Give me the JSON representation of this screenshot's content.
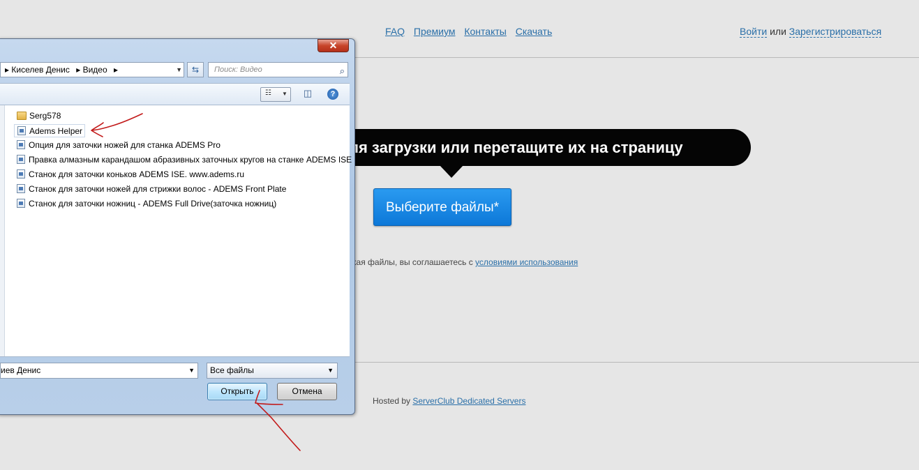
{
  "site": {
    "nav": [
      "FAQ",
      "Премиум",
      "Контакты",
      "Скачать"
    ],
    "auth": {
      "login": "Войти",
      "or": "или",
      "register": "Зарегистрироваться"
    },
    "bubble_text": "ля загрузки или перетащите их на страницу",
    "choose_button": "Выберите файлы*",
    "terms_prefix": "кая файлы, вы соглашаетесь с",
    "terms_link": "условиями использования",
    "hosted_prefix": "Hosted by",
    "hosted_link": "ServerClub Dedicated Servers"
  },
  "dialog": {
    "close_glyph": "✕",
    "address": {
      "seg1": "Киселев Денис",
      "seg2": "Видео",
      "sep": "▸"
    },
    "search_placeholder": "Поиск: Видео",
    "help_glyph": "?",
    "files": [
      {
        "name": "Serg578",
        "type": "folder"
      },
      {
        "name": "Adems Helper",
        "type": "file",
        "selected": true
      },
      {
        "name": "Опция для заточки ножей для станка ADEMS Pro",
        "type": "file"
      },
      {
        "name": "Правка алмазным карандашом абразивных заточных кругов на станке ADEMS ISE",
        "type": "file"
      },
      {
        "name": "Станок для заточки коньков ADEMS ISE. www.adems.ru",
        "type": "file"
      },
      {
        "name": "Станок для заточки ножей для стрижки волос - ADEMS Front Plate",
        "type": "file"
      },
      {
        "name": "Станок для заточки ножниц - ADEMS Full Drive(заточка ножниц)",
        "type": "file"
      }
    ],
    "filename_value": "иев Денис",
    "filetype_value": "Все файлы",
    "open_button": "Открыть",
    "cancel_button": "Отмена"
  },
  "colors": {
    "link": "#2a6fa8",
    "bubble": "#050505",
    "choose_button": "#1a87e4",
    "annotation": "#c21a1a"
  }
}
